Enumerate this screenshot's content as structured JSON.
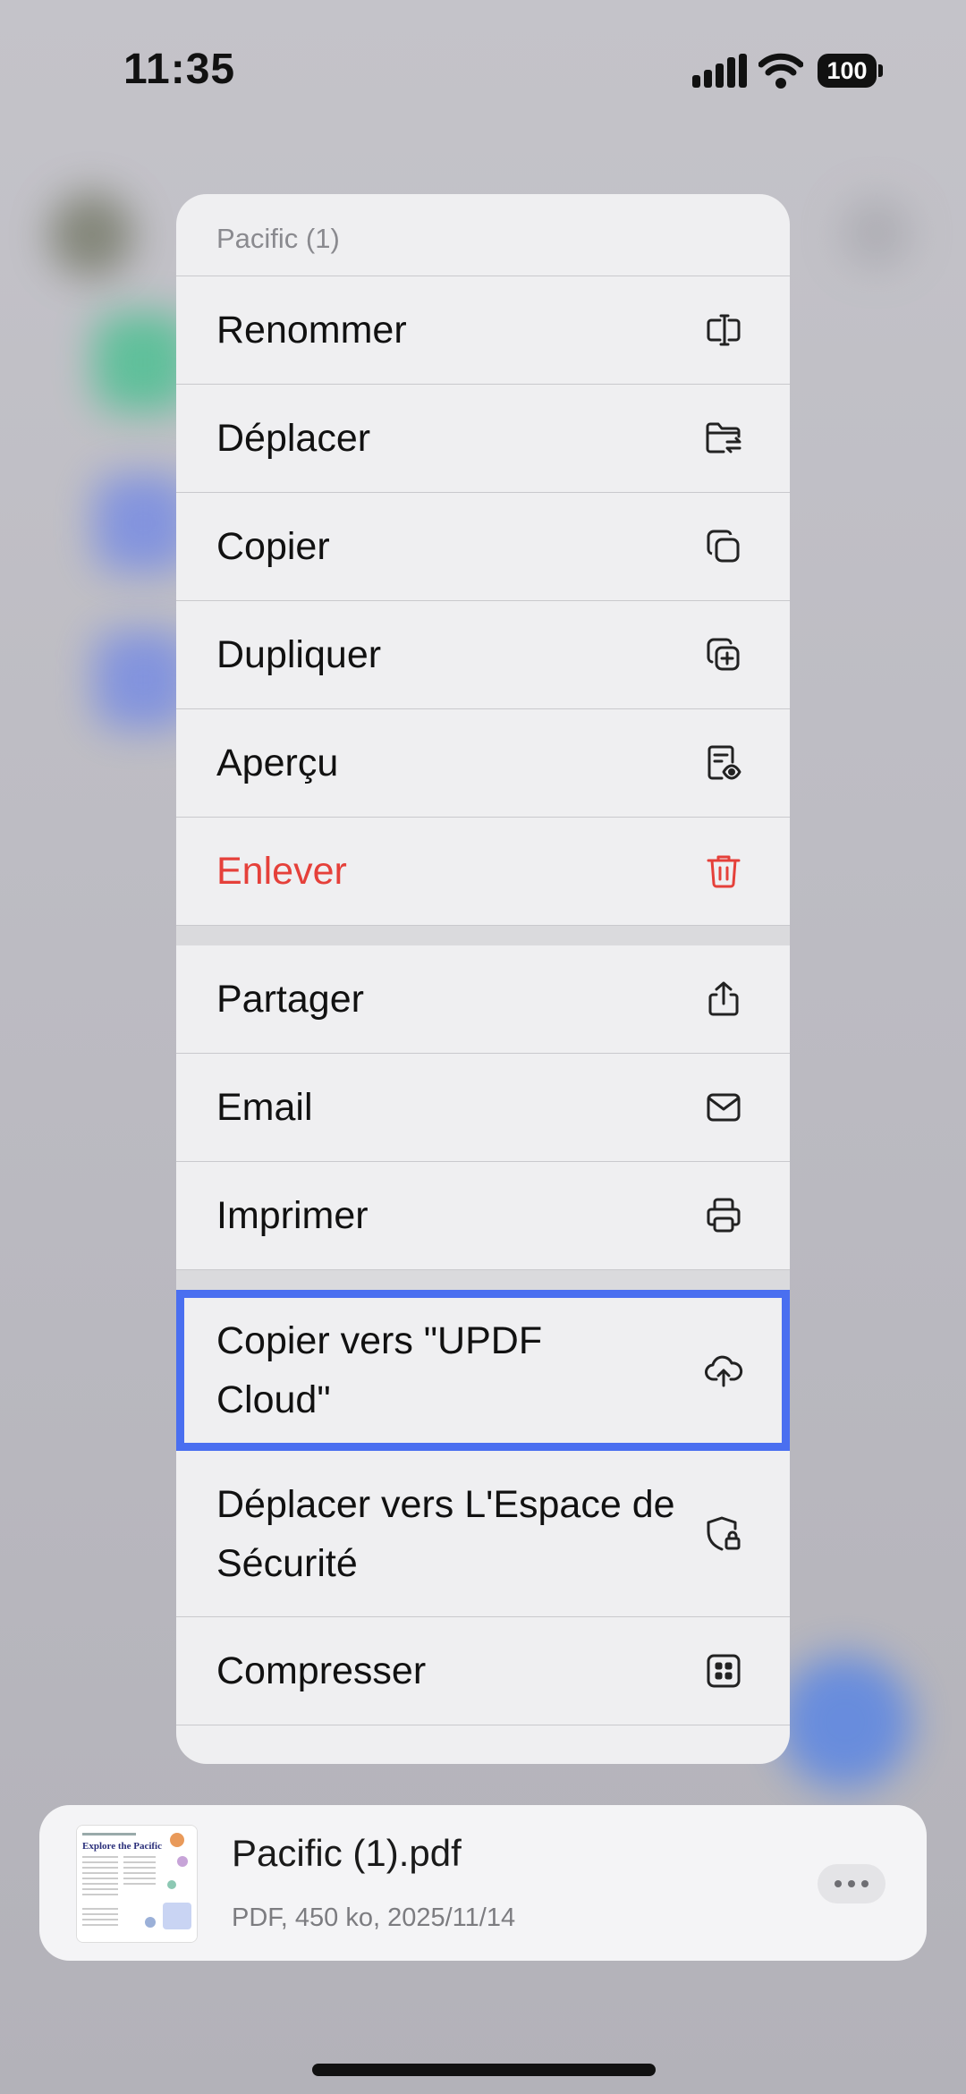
{
  "status_bar": {
    "time": "11:35",
    "battery": "100"
  },
  "menu": {
    "title": "Pacific (1)",
    "group1": [
      {
        "label": "Renommer",
        "icon": "rename-icon"
      },
      {
        "label": "Déplacer",
        "icon": "folder-move-icon"
      },
      {
        "label": "Copier",
        "icon": "copy-icon"
      },
      {
        "label": "Dupliquer",
        "icon": "duplicate-icon"
      },
      {
        "label": "Aperçu",
        "icon": "preview-icon"
      },
      {
        "label": "Enlever",
        "icon": "trash-icon",
        "color": "#e5403a"
      }
    ],
    "group2": [
      {
        "label": "Partager",
        "icon": "share-icon"
      },
      {
        "label": "Email",
        "icon": "mail-icon"
      },
      {
        "label": "Imprimer",
        "icon": "printer-icon"
      }
    ],
    "group3": [
      {
        "label": "Copier vers \"UPDF Cloud\"",
        "icon": "cloud-upload-icon"
      },
      {
        "label": "Déplacer vers L'Espace de Sécurité",
        "icon": "shield-lock-icon"
      },
      {
        "label": "Compresser",
        "icon": "compress-icon"
      }
    ]
  },
  "file": {
    "name": "Pacific (1).pdf",
    "meta": "PDF, 450 ko, 2025/11/14",
    "thumb_title": "Explore the Pacific"
  },
  "colors": {
    "highlight": "#4a6ff0",
    "destructive": "#e5403a"
  }
}
